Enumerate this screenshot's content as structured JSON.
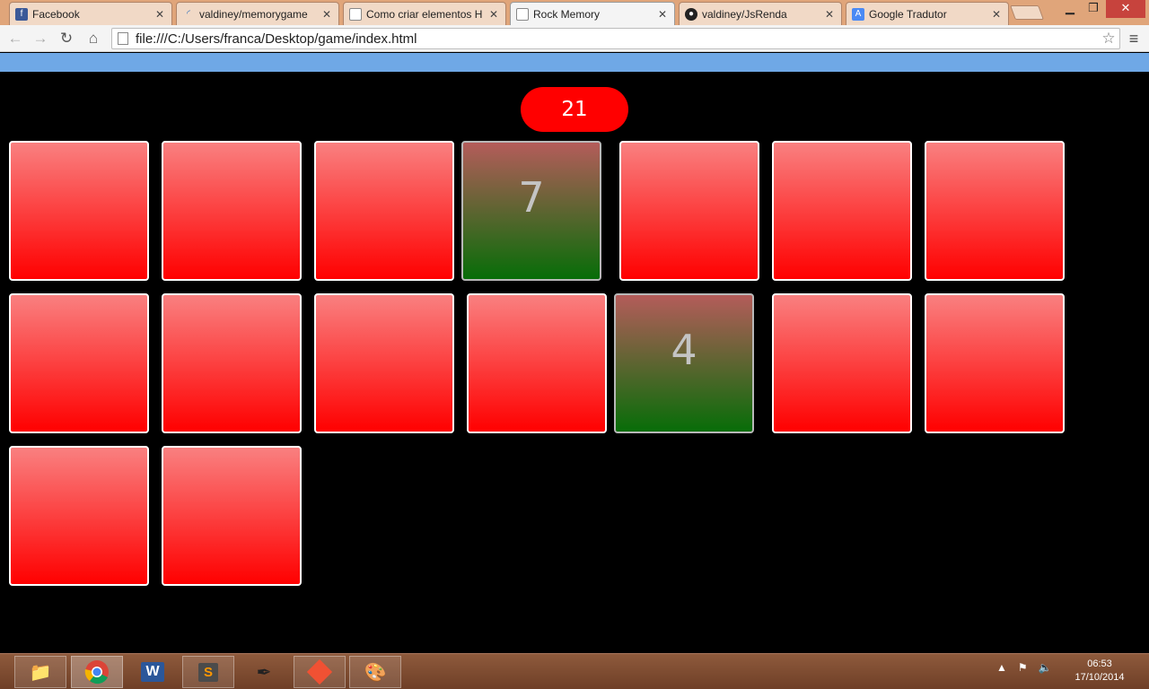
{
  "browser": {
    "tabs": [
      {
        "label": "Facebook",
        "icon": "facebook-icon"
      },
      {
        "label": "valdiney/memorygame",
        "icon": "loading-icon"
      },
      {
        "label": "Como criar elementos H",
        "icon": "page-icon"
      },
      {
        "label": "Rock Memory",
        "icon": "page-icon",
        "active": true
      },
      {
        "label": "valdiney/JsRenda",
        "icon": "github-icon"
      },
      {
        "label": "Google Tradutor",
        "icon": "translate-icon"
      }
    ],
    "url": "file:///C:/Users/franca/Desktop/game/index.html"
  },
  "game": {
    "score": "21",
    "cards": [
      {
        "row": 1,
        "flipped": false,
        "value": ""
      },
      {
        "row": 1,
        "flipped": false,
        "value": ""
      },
      {
        "row": 1,
        "flipped": false,
        "value": ""
      },
      {
        "row": 1,
        "flipped": true,
        "value": "7"
      },
      {
        "row": 1,
        "flipped": false,
        "value": ""
      },
      {
        "row": 1,
        "flipped": false,
        "value": ""
      },
      {
        "row": 1,
        "flipped": false,
        "value": ""
      },
      {
        "row": 2,
        "flipped": false,
        "value": ""
      },
      {
        "row": 2,
        "flipped": false,
        "value": ""
      },
      {
        "row": 2,
        "flipped": false,
        "value": ""
      },
      {
        "row": 2,
        "flipped": false,
        "value": ""
      },
      {
        "row": 2,
        "flipped": true,
        "value": "4"
      },
      {
        "row": 2,
        "flipped": false,
        "value": ""
      },
      {
        "row": 2,
        "flipped": false,
        "value": ""
      },
      {
        "row": 3,
        "flipped": false,
        "value": ""
      },
      {
        "row": 3,
        "flipped": false,
        "value": ""
      }
    ],
    "colors": {
      "card_top": "#f98080",
      "card_bottom": "#ff0000",
      "flipped_top": "#b45c5a",
      "flipped_bottom": "#076d08",
      "score_bg": "#ff0000",
      "topbar": "#6fa8e6"
    }
  },
  "taskbar": {
    "apps": [
      "file-explorer-icon",
      "chrome-icon",
      "word-icon",
      "sublime-text-icon",
      "color-picker-icon",
      "git-icon",
      "paint-icon"
    ],
    "clock_time": "06:53",
    "clock_date": "17/10/2014"
  }
}
